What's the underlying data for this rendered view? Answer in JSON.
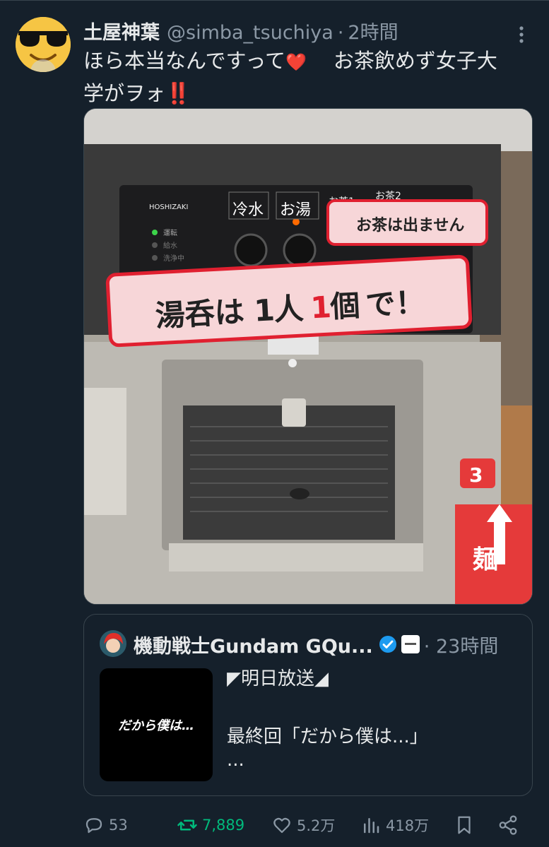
{
  "tweet": {
    "author_name": "土屋神葉",
    "handle": "@simba_tsuchiya",
    "separator": "·",
    "time": "2時間",
    "text_line1": "ほら本当なんですって",
    "text_line1b": "お茶飲めず女子大",
    "text_line2": "学がヲォ",
    "emoji_heart": "❤️",
    "emoji_bang": "‼️"
  },
  "media": {
    "brand": "HOSHIZAKI",
    "button_cold": "冷水",
    "button_hot": "お湯",
    "button_tea1": "お茶1",
    "button_tea2": "お茶2",
    "status_1": "運転",
    "status_2": "給水",
    "status_3": "洗浄中",
    "sign_no_tea": "お茶は出ません",
    "sign_cup_a": "湯呑は",
    "sign_cup_b": "1",
    "sign_cup_c": "人",
    "sign_cup_d": "1",
    "sign_cup_e": "個",
    "sign_cup_f": "で！",
    "floor_sign": "麺",
    "floor_number": "3"
  },
  "quote": {
    "author_name": "機動戦士Gundam GQu...",
    "separator": "·",
    "time": "23時間",
    "thumb_text": "だから僕は…",
    "line1": "◤明日放送◢",
    "line2": "最終回「だから僕は...」",
    "line3": "..."
  },
  "actions": {
    "replies": "53",
    "retweets": "7,889",
    "likes": "5.2万",
    "views": "418万"
  },
  "colors": {
    "background": "#15202b",
    "text": "#e7e9ea",
    "muted": "#8b98a5",
    "retweet_green": "#00ba7c",
    "verified_blue": "#1d9bf0",
    "emoji_red": "#f91880"
  }
}
